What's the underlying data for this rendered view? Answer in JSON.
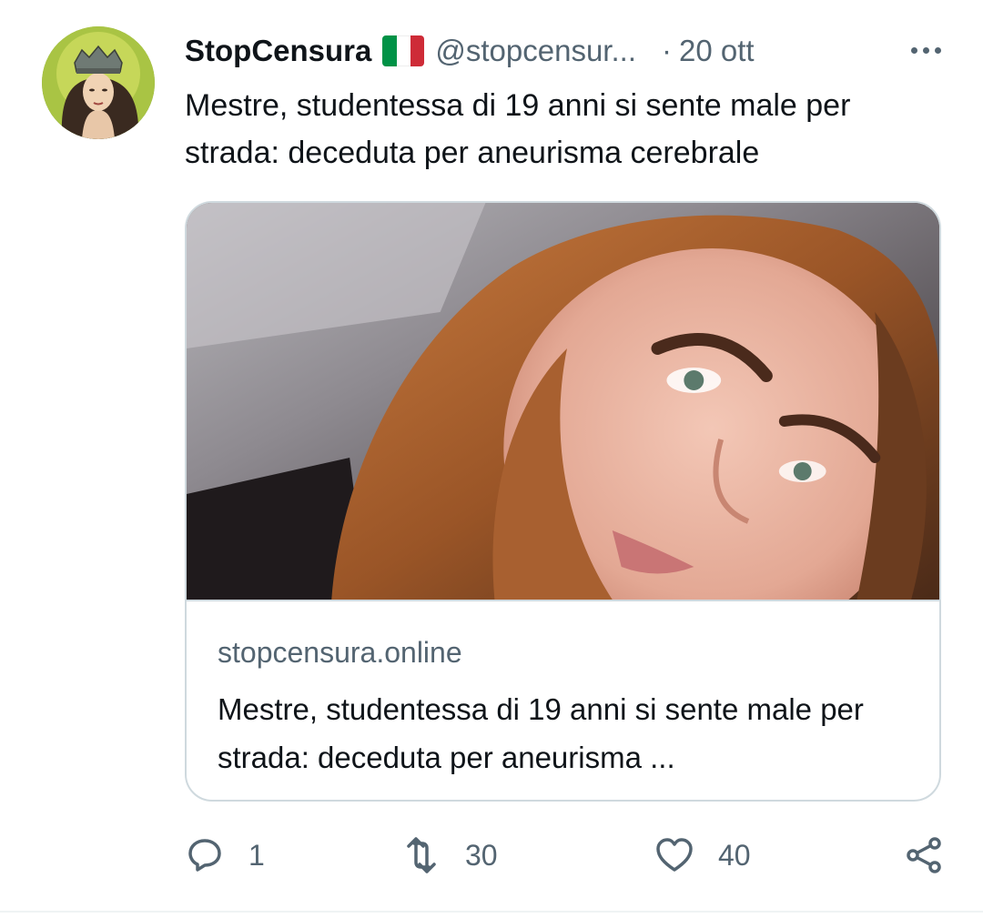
{
  "tweet": {
    "display_name": "StopCensura",
    "flag_icon": "italy-flag-icon",
    "handle": "@stopcensur...",
    "separator": "·",
    "date": "20 ott",
    "text": "Mestre, studentessa di 19 anni si sente male per strada: deceduta per aneurisma cerebrale"
  },
  "card": {
    "domain": "stopcensura.online",
    "title": "Mestre, studentessa di 19 anni si sente male per strada: deceduta per aneurisma ..."
  },
  "actions": {
    "reply_count": "1",
    "retweet_count": "30",
    "like_count": "40"
  },
  "colors": {
    "text_primary": "#0f1419",
    "text_secondary": "#536471",
    "border": "#cfd9de",
    "flag_green": "#009246",
    "flag_white": "#ffffff",
    "flag_red": "#ce2b37"
  }
}
